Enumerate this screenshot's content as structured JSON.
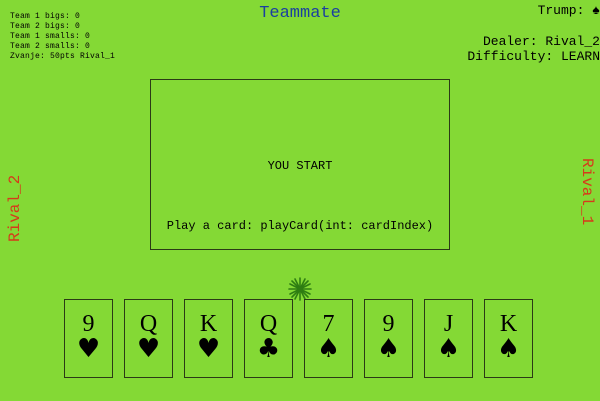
{
  "scoreboard": {
    "team1_bigs": "Team 1 bigs: 0",
    "team2_bigs": "Team 2 bigs: 0",
    "team1_smalls": "Team 1 smalls: 0",
    "team2_smalls": "Team 2 smalls: 0",
    "zvanje": "Zvanje: 50pts Rival_1"
  },
  "players": {
    "teammate": "Teammate",
    "rival_left": "Rival_2",
    "rival_right": "Rival_1"
  },
  "info": {
    "trump": "Trump: ♠",
    "dealer": "Dealer: Rival_2",
    "difficulty": "Difficulty: LEARN"
  },
  "table": {
    "status": "YOU START",
    "instruction": "Play a card: playCard(int: cardIndex)"
  },
  "turn_marker": "star-burst-icon",
  "hand": [
    {
      "rank": "9",
      "suit": "♥"
    },
    {
      "rank": "Q",
      "suit": "♥"
    },
    {
      "rank": "K",
      "suit": "♥"
    },
    {
      "rank": "Q",
      "suit": "♣"
    },
    {
      "rank": "7",
      "suit": "♠"
    },
    {
      "rank": "9",
      "suit": "♠"
    },
    {
      "rank": "J",
      "suit": "♠"
    },
    {
      "rank": "K",
      "suit": "♠"
    }
  ],
  "colors": {
    "background": "#84d935",
    "teammate": "#1a3fa0",
    "rival": "#d63a1a",
    "marker": "#2e7d12"
  }
}
